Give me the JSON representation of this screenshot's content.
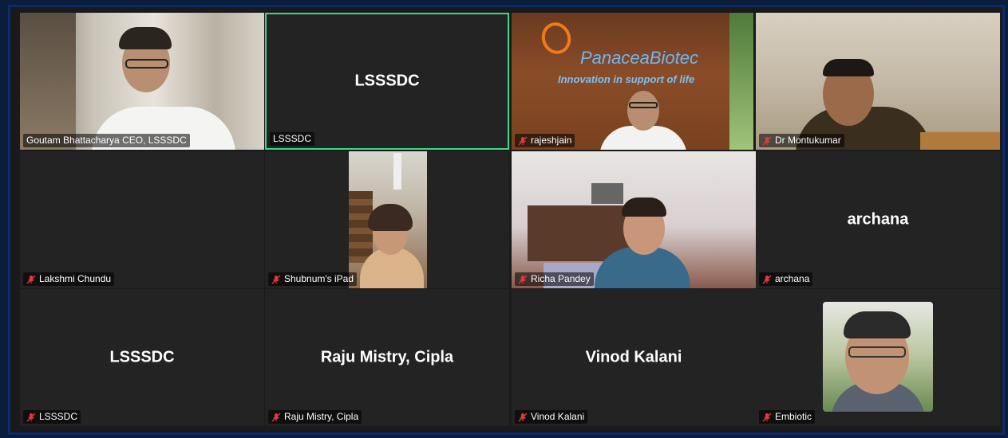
{
  "participants": [
    {
      "id": "p1",
      "display_name": "Goutam Bhattacharya CEO, LSSSDC",
      "video": true,
      "muted": false
    },
    {
      "id": "p2",
      "display_name": "LSSSDC",
      "center_text": "LSSSDC",
      "video": false,
      "muted": false,
      "active_speaker": true
    },
    {
      "id": "p3",
      "display_name": "rajeshjain",
      "video": true,
      "muted": true,
      "background_text": "PanaceaBiotec",
      "background_tagline": "Innovation in support of life"
    },
    {
      "id": "p4",
      "display_name": "Dr Montukumar",
      "video": true,
      "muted": true
    },
    {
      "id": "p5",
      "display_name": "Lakshmi Chundu",
      "video": false,
      "muted": true
    },
    {
      "id": "p6",
      "display_name": "Shubnum's iPad",
      "video": true,
      "muted": true
    },
    {
      "id": "p7",
      "display_name": "Richa Pandey",
      "video": true,
      "muted": true
    },
    {
      "id": "p8",
      "display_name": "archana",
      "center_text": "archana",
      "video": false,
      "muted": true
    },
    {
      "id": "p9",
      "display_name": "LSSSDC",
      "center_text": "LSSSDC",
      "video": false,
      "muted": true
    },
    {
      "id": "p10",
      "display_name": "Raju Mistry, Cipla",
      "center_text": "Raju Mistry, Cipla",
      "video": false,
      "muted": true
    },
    {
      "id": "p11",
      "display_name": "Vinod Kalani",
      "center_text": "Vinod Kalani",
      "video": false,
      "muted": true
    },
    {
      "id": "p12",
      "display_name": "Embiotic",
      "video": true,
      "muted": true
    }
  ],
  "colors": {
    "active_speaker_border": "#39d98a",
    "muted_icon": "#e0383e",
    "tile_background": "#232323",
    "frame_border": "#0a2a6b"
  },
  "icons": {
    "muted": "microphone-muted-icon"
  }
}
